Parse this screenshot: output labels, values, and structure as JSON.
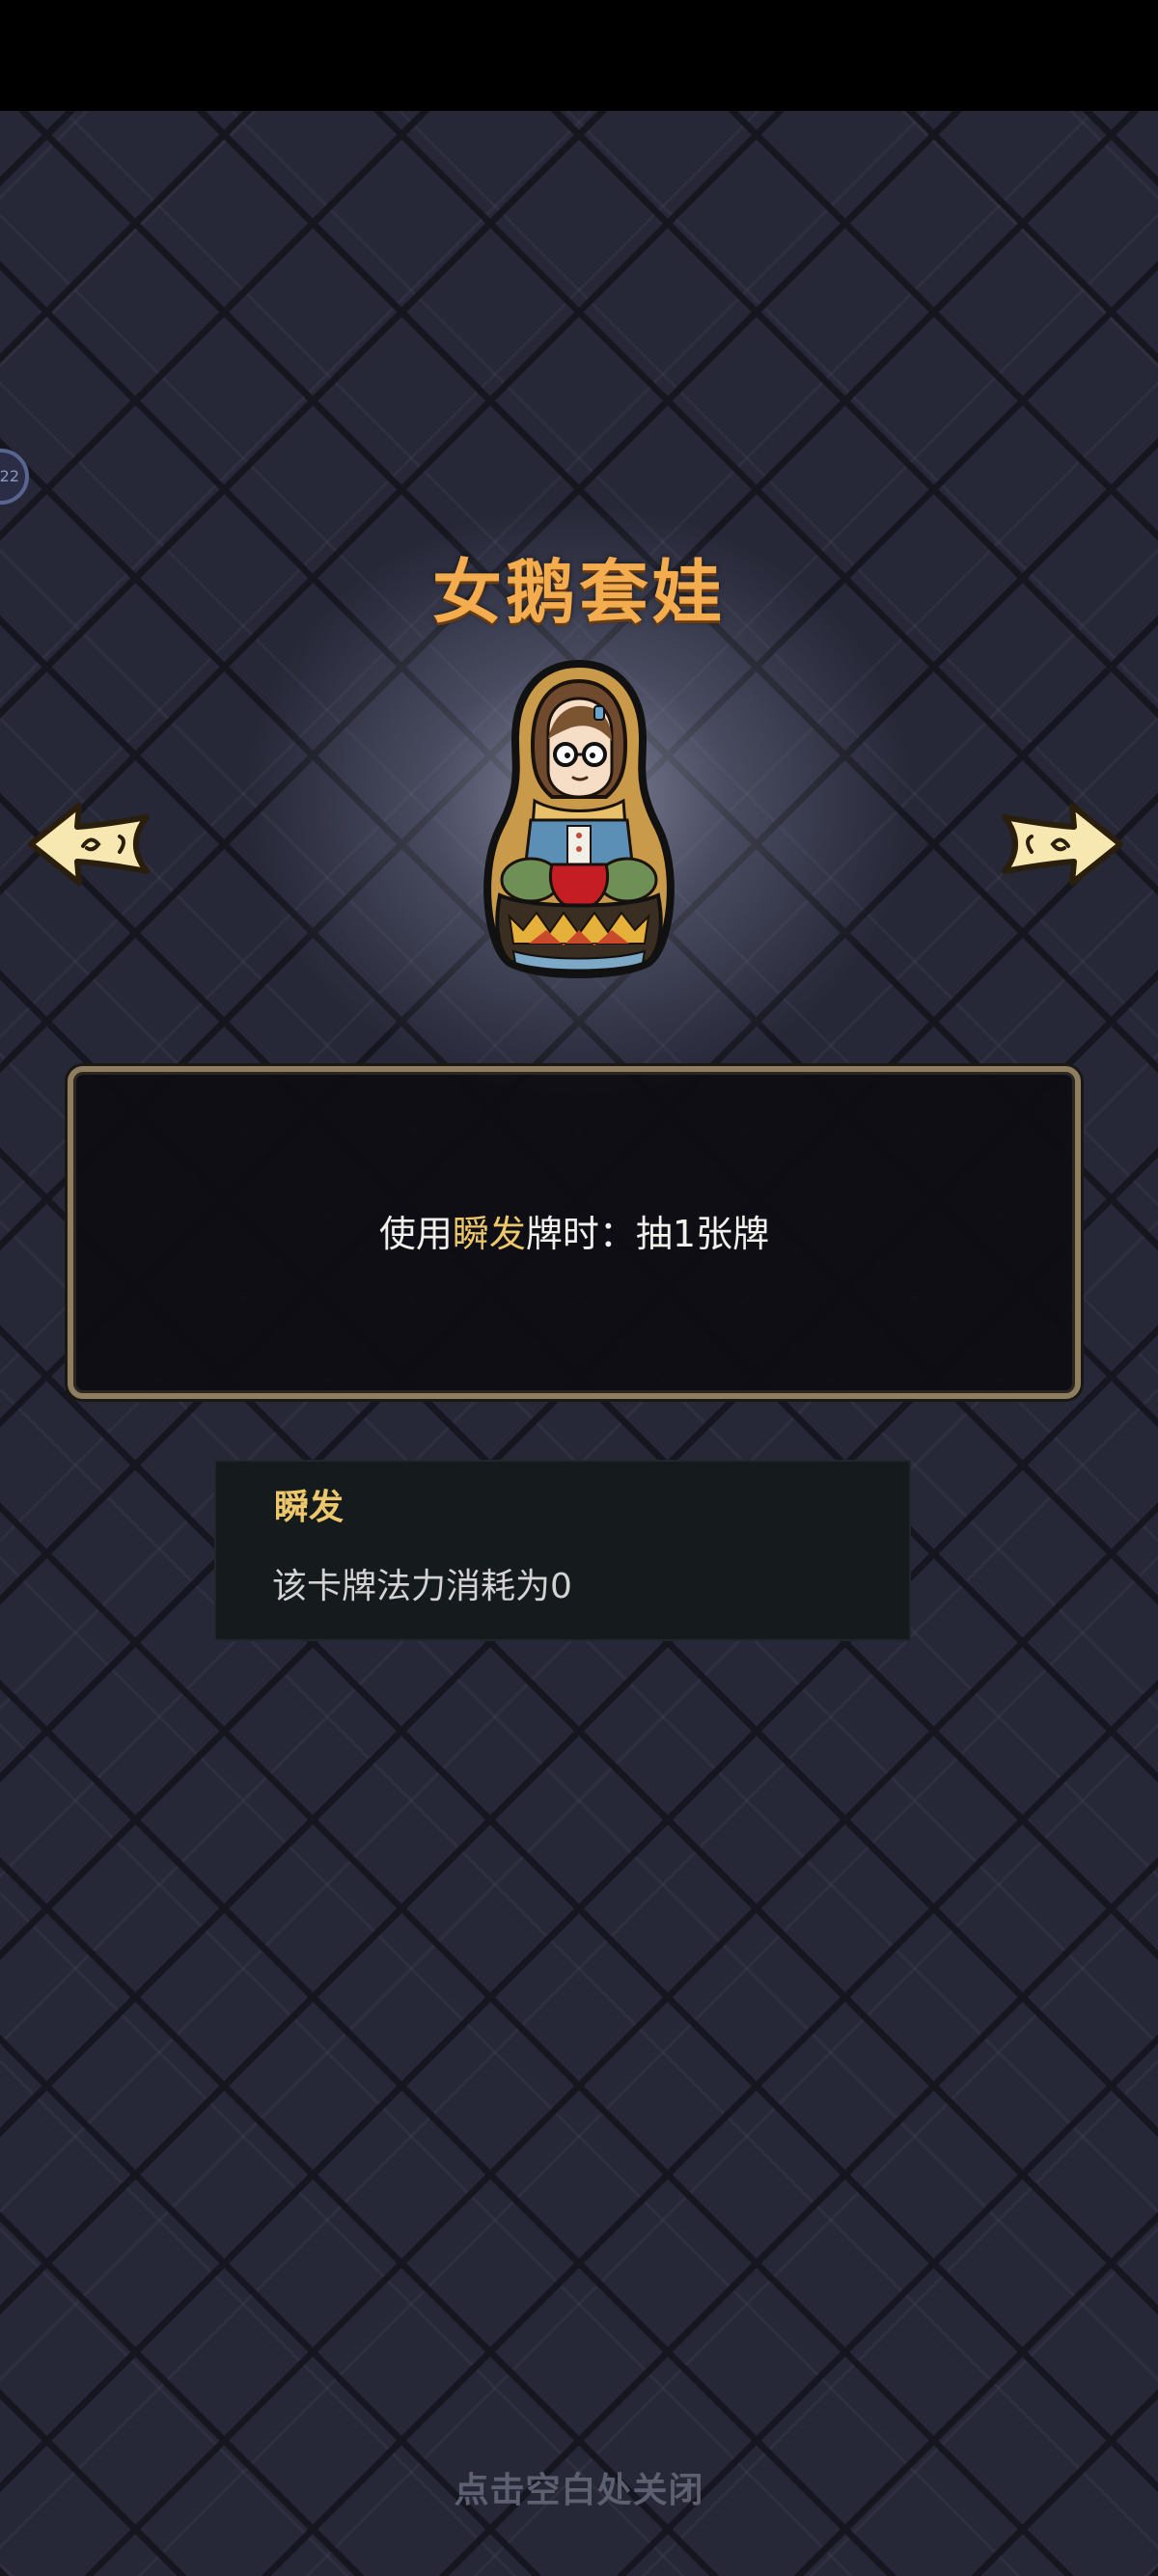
{
  "side_badge": {
    "label": "22"
  },
  "card": {
    "title": "女鹅套娃",
    "image_icon": "nesting-doll-icon",
    "description": {
      "prefix": "使用",
      "keyword": "瞬发",
      "suffix": "牌时：抽1张牌"
    }
  },
  "navigation": {
    "prev_icon": "left-arrow-icon",
    "next_icon": "right-arrow-icon"
  },
  "keyword_tooltip": {
    "title": "瞬发",
    "description": "该卡牌法力消耗为0"
  },
  "footer": {
    "close_hint": "点击空白处关闭"
  },
  "colors": {
    "title": "#f3ad4f",
    "keyword": "#ecc76b",
    "panel_border": "#8e7d5f"
  }
}
